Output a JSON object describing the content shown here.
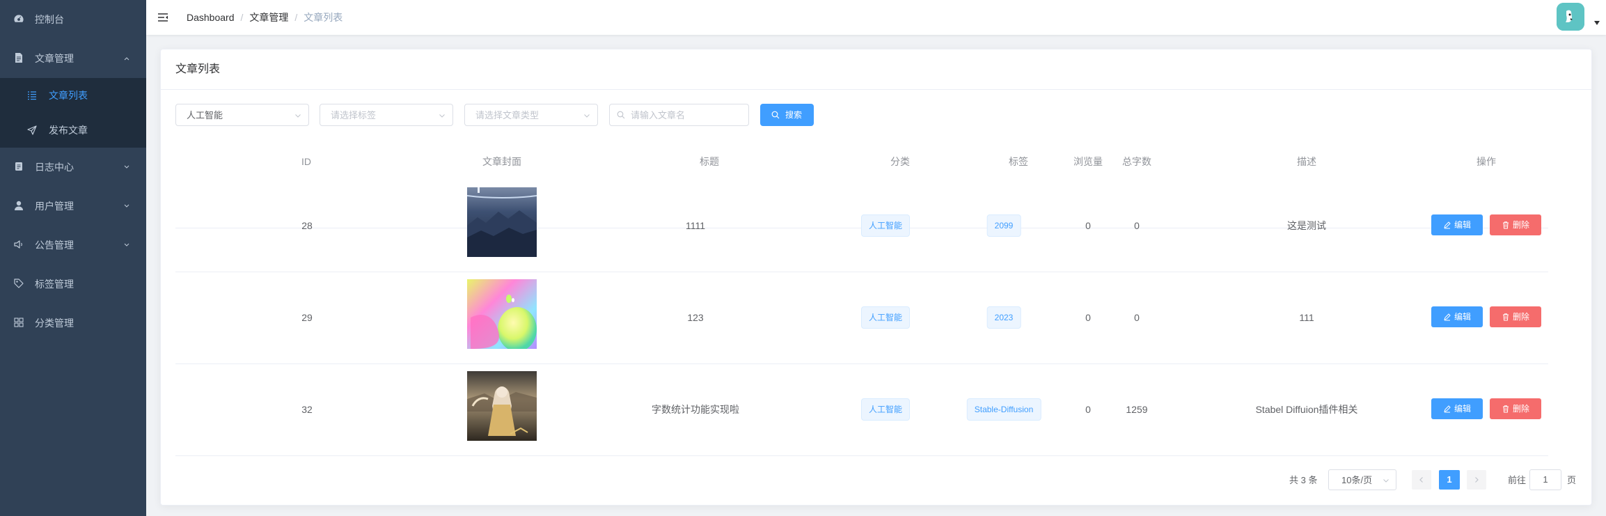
{
  "sidebar": {
    "items": [
      {
        "label": "控制台",
        "icon": "dashboard-icon"
      },
      {
        "label": "文章管理",
        "icon": "document-icon",
        "expanded": true,
        "children": [
          {
            "label": "文章列表",
            "icon": "list-icon",
            "active": true
          },
          {
            "label": "发布文章",
            "icon": "send-icon"
          }
        ]
      },
      {
        "label": "日志中心",
        "icon": "log-icon"
      },
      {
        "label": "用户管理",
        "icon": "user-icon"
      },
      {
        "label": "公告管理",
        "icon": "speaker-icon"
      },
      {
        "label": "标签管理",
        "icon": "tag-icon"
      },
      {
        "label": "分类管理",
        "icon": "grid-icon"
      }
    ]
  },
  "header": {
    "breadcrumb": [
      "Dashboard",
      "文章管理",
      "文章列表"
    ]
  },
  "card": {
    "title": "文章列表"
  },
  "filters": {
    "category_value": "人工智能",
    "tag_placeholder": "请选择标签",
    "type_placeholder": "请选择文章类型",
    "name_placeholder": "请输入文章名",
    "search_label": "搜索"
  },
  "table": {
    "columns": [
      "ID",
      "文章封面",
      "标题",
      "分类",
      "标签",
      "浏览量",
      "总字数",
      "描述",
      "操作"
    ],
    "rows": [
      {
        "id": "28",
        "title": "1111",
        "category": "人工智能",
        "tag": "2099",
        "views": "0",
        "words": "0",
        "desc": "这是测试"
      },
      {
        "id": "29",
        "title": "123",
        "category": "人工智能",
        "tag": "2023",
        "views": "0",
        "words": "0",
        "desc": "111"
      },
      {
        "id": "32",
        "title": "字数统计功能实现啦",
        "category": "人工智能",
        "tag": "Stable-Diffusion",
        "views": "0",
        "words": "1259",
        "desc": "Stabel Diffuion插件相关"
      }
    ],
    "edit_label": "编辑",
    "delete_label": "删除"
  },
  "pagination": {
    "total": "共 3 条",
    "page_size": "10条/页",
    "current_page": "1",
    "goto_prefix": "前往",
    "goto_value": "1",
    "goto_suffix": "页"
  },
  "colors": {
    "sidebar_bg": "#304156",
    "submenu_bg": "#1f2d3d",
    "primary": "#409eff",
    "danger": "#f56c6c"
  }
}
